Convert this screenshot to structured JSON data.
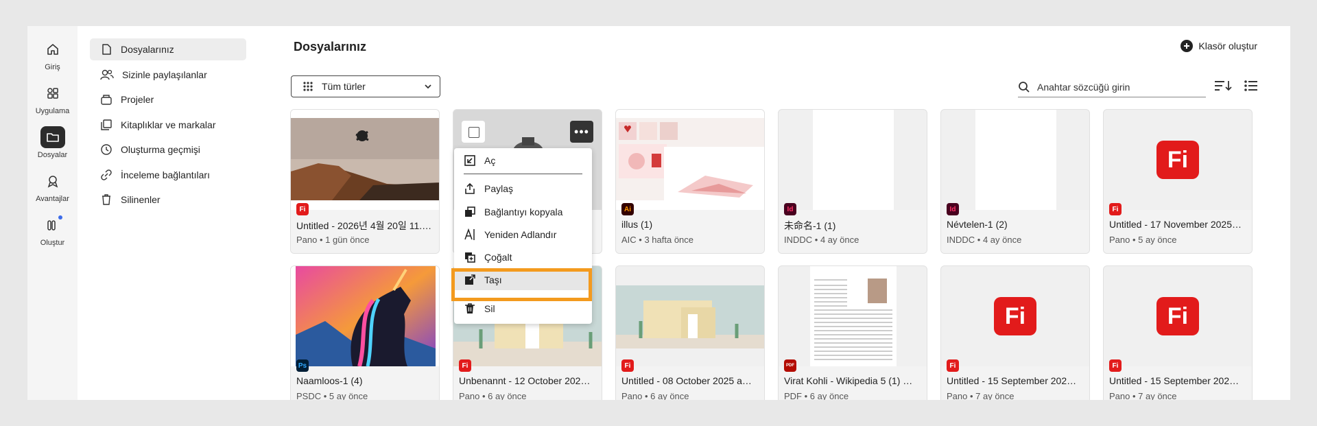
{
  "rail": {
    "items": [
      {
        "label": "Giriş",
        "icon": "home-icon"
      },
      {
        "label": "Uygulama",
        "icon": "apps-icon"
      },
      {
        "label": "Dosyalar",
        "icon": "folder-icon",
        "active": true
      },
      {
        "label": "Avantajlar",
        "icon": "award-icon"
      },
      {
        "label": "Oluştur",
        "icon": "create-icon"
      }
    ]
  },
  "sidebar": {
    "items": [
      {
        "label": "Dosyalarınız",
        "icon": "file-icon",
        "active": true
      },
      {
        "label": "Sizinle paylaşılanlar",
        "icon": "people-icon"
      },
      {
        "label": "Projeler",
        "icon": "projects-icon"
      },
      {
        "label": "Kitaplıklar ve markalar",
        "icon": "library-icon"
      },
      {
        "label": "Oluşturma geçmişi",
        "icon": "history-icon"
      },
      {
        "label": "İnceleme bağlantıları",
        "icon": "link-icon"
      },
      {
        "label": "Silinenler",
        "icon": "trash-icon"
      }
    ]
  },
  "main": {
    "title": "Dosyalarınız",
    "create_folder": "Klasör oluştur",
    "filter_label": "Tüm türler",
    "search_placeholder": "Anahtar sözcüğü girin"
  },
  "cards": [
    {
      "name": "Untitled - 2026년 4월 20일 11.…",
      "meta": "Pano • 1 gün önce",
      "badge": "Fi",
      "badge_color": "#e21b1b",
      "thumb": "cliff-photo"
    },
    {
      "name": "…",
      "meta": "",
      "badge": "",
      "thumb": "gray-object",
      "selected": true
    },
    {
      "name": "illus (1)",
      "meta": "AIC • 3 hafta önce",
      "badge": "Ai",
      "badge_color": "#330000",
      "thumb": "illustration"
    },
    {
      "name": "未命名-1 (1)",
      "meta": "INDDC • 4 ay önce",
      "badge": "Id",
      "badge_color": "#49021f",
      "thumb": "white-page"
    },
    {
      "name": "Névtelen-1 (2)",
      "meta": "INDDC • 4 ay önce",
      "badge": "Id",
      "badge_color": "#49021f",
      "thumb": "white-page"
    },
    {
      "name": "Untitled - 17 November 2025…",
      "meta": "Pano • 5 ay önce",
      "badge": "Fi",
      "badge_color": "#e21b1b",
      "thumb": "fi-logo"
    },
    {
      "name": "Naamloos-1 (4)",
      "meta": "PSDC • 5 ay önce",
      "badge": "Ps",
      "badge_color": "#001e36",
      "thumb": "unicorn"
    },
    {
      "name": "Unbenannt - 12 October 202…",
      "meta": "Pano • 6 ay önce",
      "badge": "Fi",
      "badge_color": "#e21b1b",
      "thumb": "house"
    },
    {
      "name": "Untitled - 08 October 2025 a…",
      "meta": "Pano • 6 ay önce",
      "badge": "Fi",
      "badge_color": "#e21b1b",
      "thumb": "house"
    },
    {
      "name": "Virat Kohli - Wikipedia 5 (1) …",
      "meta": "PDF • 6 ay önce",
      "badge": "PDF",
      "badge_color": "#b30b00",
      "thumb": "document"
    },
    {
      "name": "Untitled - 15 September 202…",
      "meta": "Pano • 7 ay önce",
      "badge": "Fi",
      "badge_color": "#e21b1b",
      "thumb": "fi-logo"
    },
    {
      "name": "Untitled - 15 September 202…",
      "meta": "Pano • 7 ay önce",
      "badge": "Fi",
      "badge_color": "#e21b1b",
      "thumb": "fi-logo"
    }
  ],
  "fi_logo_text": "Fi",
  "more_label": "•••",
  "context_menu": {
    "items": [
      {
        "label": "Aç",
        "icon": "open-icon"
      },
      {
        "label": "Paylaş",
        "icon": "share-icon"
      },
      {
        "label": "Bağlantıyı kopyala",
        "icon": "copy-link-icon"
      },
      {
        "label": "Yeniden Adlandır",
        "icon": "rename-icon"
      },
      {
        "label": "Çoğalt",
        "icon": "duplicate-icon"
      },
      {
        "label": "Taşı",
        "icon": "move-icon",
        "highlighted": true
      },
      {
        "label": "Sil",
        "icon": "delete-icon"
      }
    ]
  },
  "colors": {
    "accent_highlight": "#f39a1e",
    "fi_red": "#e21b1b",
    "rail_active": "#2c2c2c"
  }
}
